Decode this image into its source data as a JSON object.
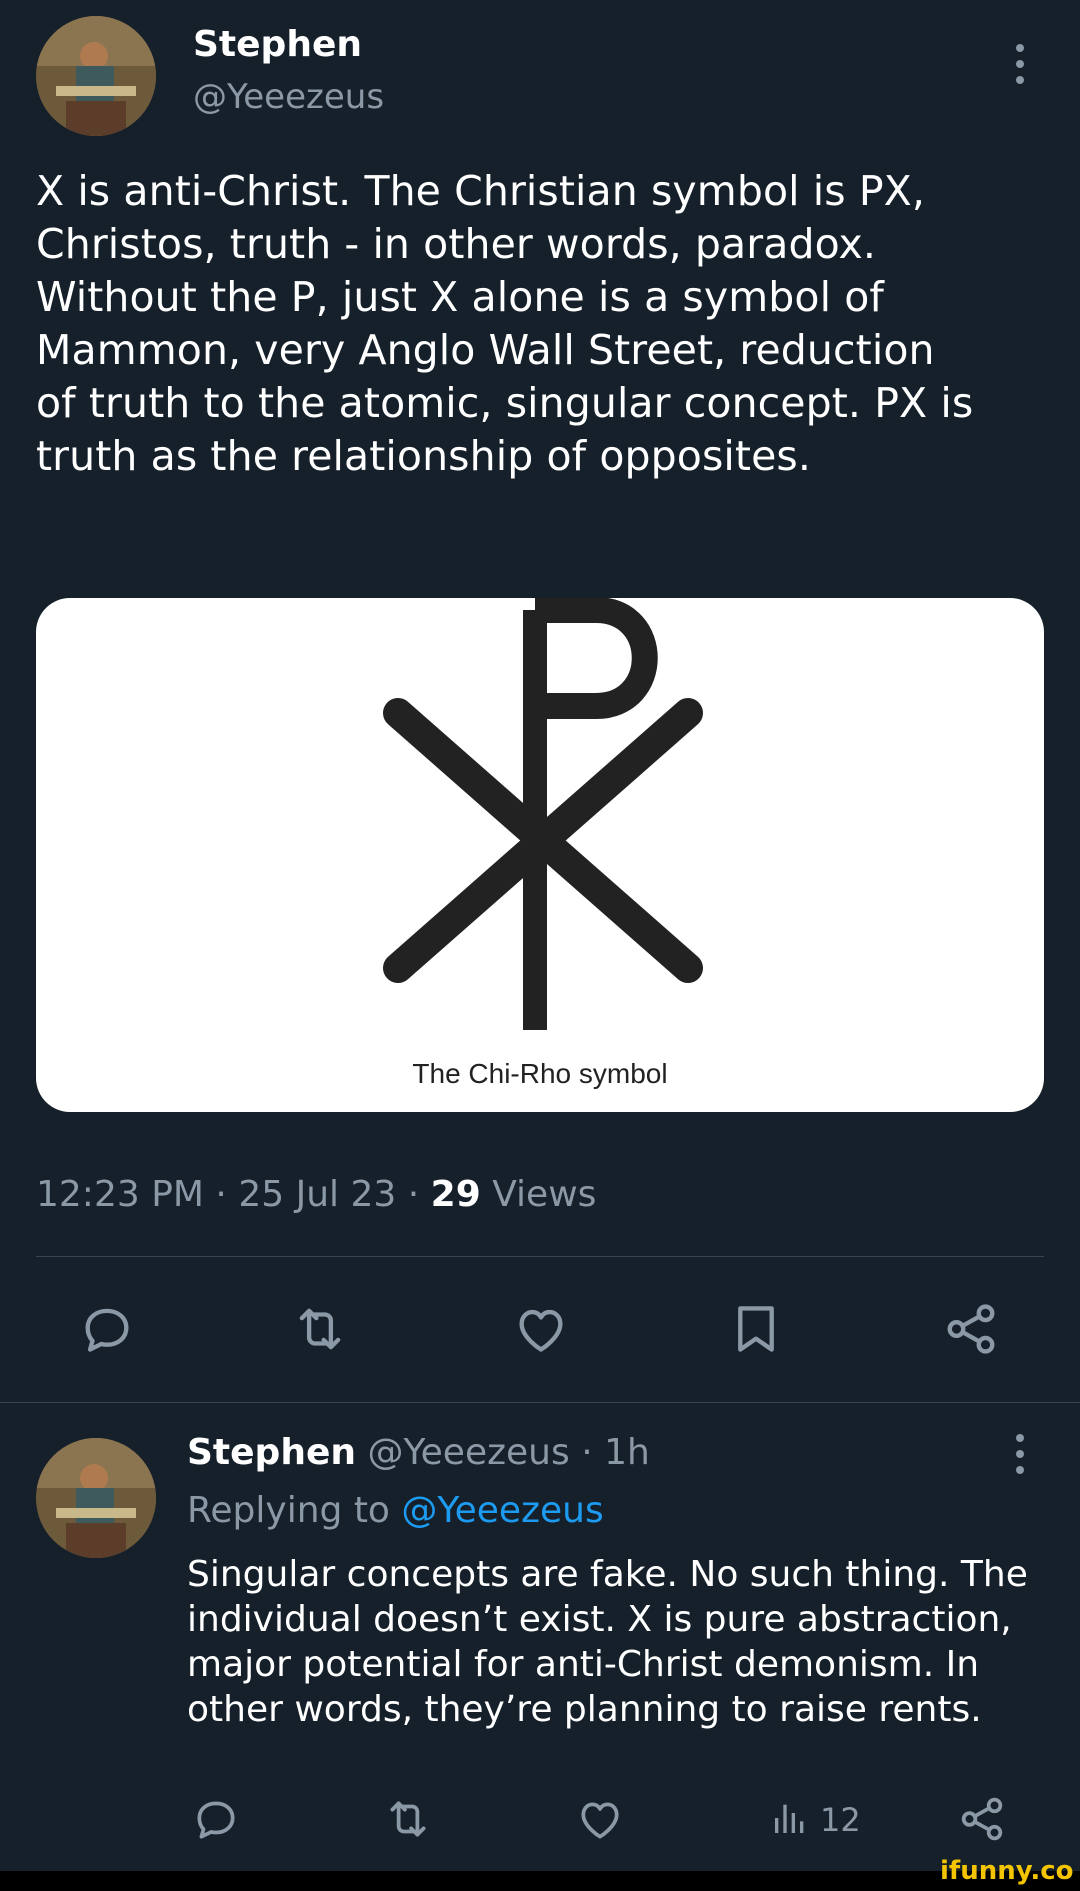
{
  "tweet": {
    "author_name": "Stephen",
    "author_handle": "@Yeeezeus",
    "text_lines": [
      "X is anti-Christ. The Christian symbol is PX,",
      "Christos, truth - in other words, paradox.",
      "Without the P, just X alone is a symbol of",
      "Mammon, very Anglo Wall Street, reduction",
      "of truth to the atomic, singular concept. PX is",
      "truth as the relationship of opposites."
    ],
    "media_caption": "The Chi-Rho symbol",
    "time": "12:23 PM",
    "date": "25 Jul 23",
    "separator": "·",
    "views_count": "29",
    "views_label": "Views"
  },
  "actions": {
    "reply_icon": "reply-icon",
    "retweet_icon": "retweet-icon",
    "like_icon": "heart-icon",
    "bookmark_icon": "bookmark-icon",
    "share_icon": "share-icon"
  },
  "reply": {
    "author_name": "Stephen",
    "author_handle": "@Yeeezeus",
    "separator": "·",
    "age": "1h",
    "replying_label": "Replying to",
    "replying_handle": "@Yeeezeus",
    "text_lines": [
      "Singular concepts are fake. No such thing. The",
      "individual doesn’t exist. X is pure abstraction,",
      "major potential for anti-Christ demonism. In",
      "other words, they’re planning to raise rents."
    ],
    "views_count": "12"
  },
  "watermark": "ifunny.co",
  "colors": {
    "background": "#15202b",
    "secondary_text": "#8b98a5",
    "link": "#1d9bf0",
    "divider": "#38444d",
    "watermark": "#f5c400"
  }
}
